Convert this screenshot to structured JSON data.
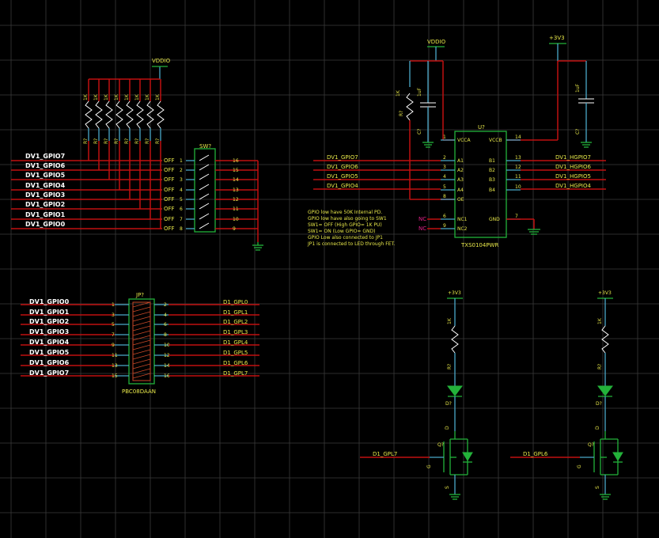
{
  "power": {
    "vddio": "VDDIO",
    "p3v3": "+3V3"
  },
  "left_bus": {
    "nets": [
      "DV1_GPIO7",
      "DV1_GPIO6",
      "DV1_GPIO5",
      "DV1_GPIO4",
      "DV1_GPIO3",
      "DV1_GPIO2",
      "DV1_GPIO1",
      "DV1_GPIO0"
    ]
  },
  "pullups": {
    "value": "1K",
    "ref": "R?"
  },
  "sw": {
    "ref": "SW?",
    "off": "OFF",
    "left_pins": [
      "1",
      "2",
      "3",
      "4",
      "5",
      "6",
      "7",
      "8"
    ],
    "right_pins": [
      "16",
      "15",
      "14",
      "13",
      "12",
      "11",
      "10",
      "9"
    ]
  },
  "level_shifter": {
    "ref": "U?",
    "part": "TXS0104PWR",
    "in_nets": [
      "DV1_GPIO7",
      "DV1_GPIO6",
      "DV1_GPIO5",
      "DV1_GPIO4"
    ],
    "out_nets": [
      "DV1_HGPIO7",
      "DV1_HGPIO6",
      "DV1_HGPIO5",
      "DV1_HGPIO4"
    ],
    "left_pins": [
      {
        "num": "1",
        "name": "VCCA"
      },
      {
        "num": "2",
        "name": "A1"
      },
      {
        "num": "3",
        "name": "A2"
      },
      {
        "num": "4",
        "name": "A3"
      },
      {
        "num": "5",
        "name": "A4"
      },
      {
        "num": "8",
        "name": "OE"
      },
      {
        "num": "6",
        "name": "NC1"
      },
      {
        "num": "9",
        "name": "NC2"
      }
    ],
    "right_pins": [
      {
        "num": "14",
        "name": "VCCB"
      },
      {
        "num": "13",
        "name": "B1"
      },
      {
        "num": "12",
        "name": "B2"
      },
      {
        "num": "11",
        "name": "B3"
      },
      {
        "num": "10",
        "name": "B4"
      },
      {
        "num": "7",
        "name": "GND"
      }
    ],
    "nc": "NC",
    "cap": {
      "value": "1uF",
      "ref": "C?"
    },
    "res": {
      "value": "1K",
      "ref": "R?"
    }
  },
  "notes": [
    "GPIO low have 50K Internal PD.",
    "GPIO low have also going to SW1",
    "SW1= OFF (High GPIO= 1K PU)",
    "SW1= ON  (Low  GPIO= GND)",
    "GPIO Low also connected to JP1",
    "JP1 is connected to LED through FET."
  ],
  "jumper": {
    "ref": "JP?",
    "part": "PBC08DAAN",
    "left_nets": [
      "DV1_GPIO0",
      "DV1_GPIO1",
      "DV1_GPIO2",
      "DV1_GPIO3",
      "DV1_GPIO4",
      "DV1_GPIO5",
      "DV1_GPIO6",
      "DV1_GPIO7"
    ],
    "left_pins": [
      "1",
      "3",
      "5",
      "7",
      "9",
      "11",
      "13",
      "15"
    ],
    "right_pins": [
      "2",
      "4",
      "6",
      "8",
      "10",
      "12",
      "14",
      "16"
    ],
    "right_nets": [
      "D1_GPL0",
      "D1_GPL1",
      "D1_GPL2",
      "D1_GPL3",
      "D1_GPL4",
      "D1_GPL5",
      "D1_GPL6",
      "D1_GPL7"
    ]
  },
  "led_drivers": [
    {
      "supply": "+3V3",
      "res_value": "1K",
      "res_ref": "R?",
      "led_ref": "D?",
      "fet_ref": "Q?",
      "gate_net": "D1_GPL7",
      "d": "D",
      "g": "G",
      "s": "S"
    },
    {
      "supply": "+3V3",
      "res_value": "1K",
      "res_ref": "R?",
      "led_ref": "D?",
      "fet_ref": "Q?",
      "gate_net": "D1_GPL6",
      "d": "D",
      "g": "G",
      "s": "S"
    }
  ]
}
